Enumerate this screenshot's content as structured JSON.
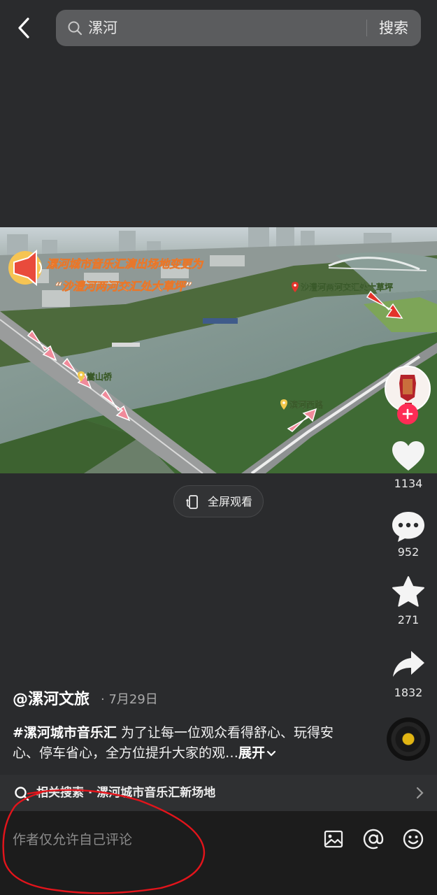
{
  "search": {
    "query": "漯河",
    "button_label": "搜索"
  },
  "video": {
    "overlay_title_line1": "漯河城市音乐汇演出场地变更为",
    "overlay_title_line2": "“沙澧河两河交汇处大草坪”",
    "pin_venue": "沙澧河两河交汇处大草坪",
    "pin_bridge": "嵩山桥",
    "pin_road": "滨河西路"
  },
  "fullscreen": {
    "label": "全屏观看"
  },
  "rail": {
    "likes": "1134",
    "comments": "952",
    "favorites": "271",
    "shares": "1832"
  },
  "post": {
    "author": "@漯河文旅",
    "date": "· 7月29日",
    "hashtag": "#漯河城市音乐汇",
    "text": " 为了让每一位观众看得舒心、玩得安心、停车省心，全方位提升大家的观…",
    "expand_label": "展开"
  },
  "related": {
    "label": "相关搜索 · 漯河城市音乐汇新场地"
  },
  "comment": {
    "placeholder": "作者仅允许自己评论"
  },
  "colors": {
    "background": "#2a2b2d",
    "accent_red": "#fe2c55",
    "annotation_red": "#e3141b"
  }
}
